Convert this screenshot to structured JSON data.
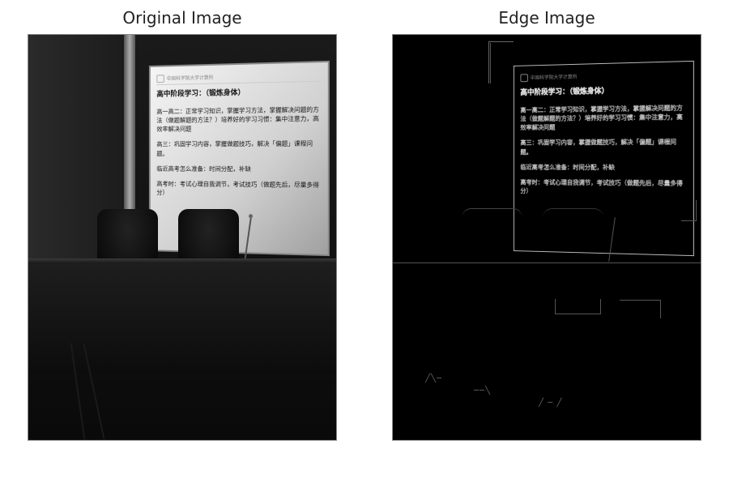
{
  "titles": {
    "left": "Original Image",
    "right": "Edge Image"
  },
  "slide": {
    "logo_text": "中国科学院大学计算所",
    "heading": "高中阶段学习：（锻炼身体）",
    "p1": "高一高二：正常学习知识，掌握学习方法，掌握解决问题的方法（做题解题的方法？）培养好的学习习惯：集中注意力，高效率解决问题",
    "p2": "高三：巩固学习内容，掌握做题技巧，解决「偏题」课程问题。",
    "p3": "临近高考怎么准备：时间分配，补缺",
    "p4": "高考时：考试心理自我调节，考试技巧（做题先后，尽量多得分）"
  }
}
